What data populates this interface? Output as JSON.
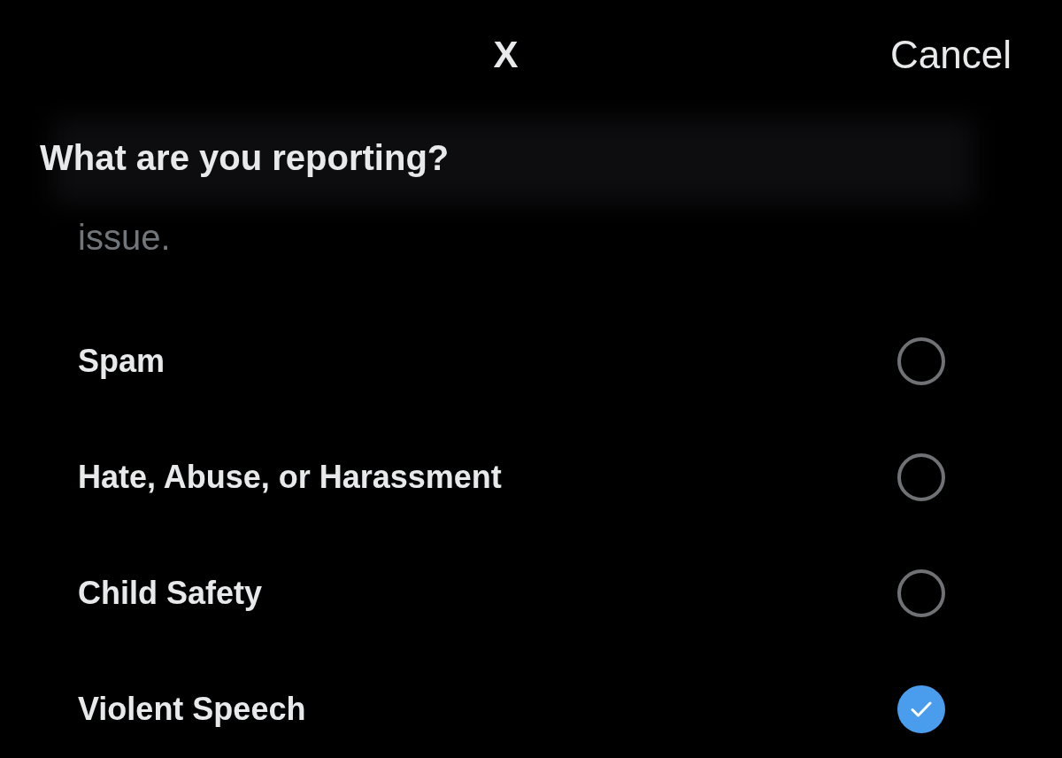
{
  "header": {
    "logo": "X",
    "cancel": "Cancel"
  },
  "title": "What are you reporting?",
  "description_tail": "issue.",
  "options": [
    {
      "label": "Spam",
      "selected": false
    },
    {
      "label": "Hate, Abuse, or Harassment",
      "selected": false
    },
    {
      "label": "Child Safety",
      "selected": false
    },
    {
      "label": "Violent Speech",
      "selected": true
    }
  ]
}
